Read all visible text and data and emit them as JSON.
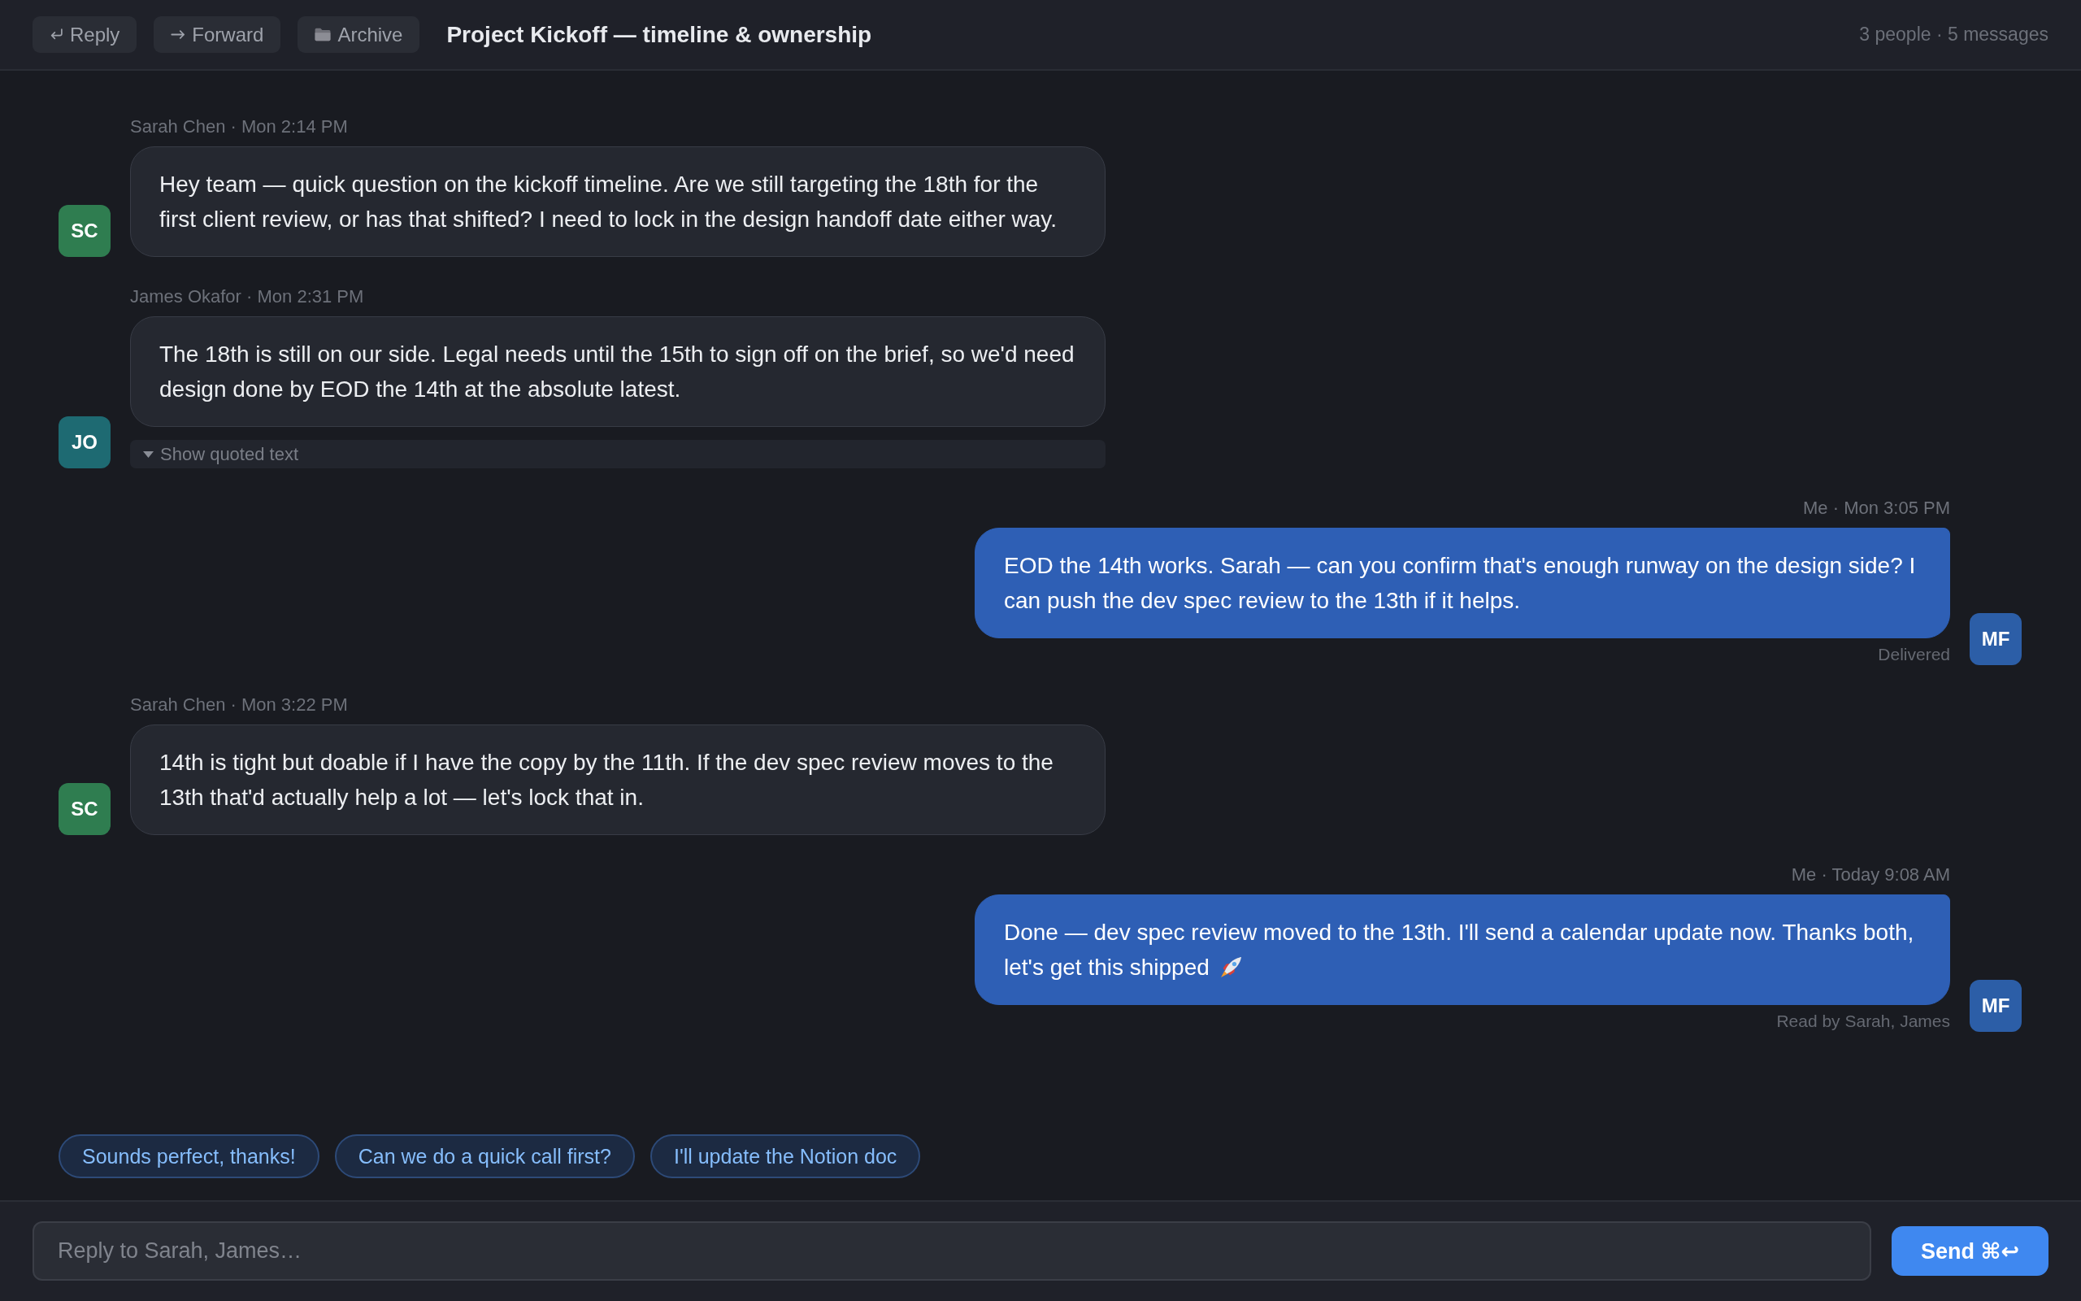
{
  "header": {
    "buttons": [
      {
        "kind": "reply",
        "label": "Reply"
      },
      {
        "kind": "forward",
        "label": "Forward"
      },
      {
        "kind": "archive",
        "label": "Archive"
      }
    ],
    "title": "Project Kickoff — timeline & ownership",
    "summary": "3 people · 5 messages"
  },
  "messages": [
    {
      "kind": "received",
      "meta": "Sarah Chen · Mon 2:14 PM",
      "initials": "SC",
      "color": "#2f7d50",
      "text": "Hey team — quick question on the kickoff timeline. Are we still targeting the 18th for the first client review, or has that shifted? I need to lock in the design handoff date either way."
    },
    {
      "kind": "received",
      "meta": "James Okafor · Mon 2:31 PM",
      "initials": "JO",
      "color": "#1e6a72",
      "text": "The 18th is still on our side. Legal needs until the 15th to sign off on the brief, so we'd need design done by EOD the 14th at the absolute latest.",
      "quoted_toggle": "Show quoted text"
    },
    {
      "kind": "sent",
      "meta": "Me · Mon 3:05 PM",
      "initials": "MF",
      "color": "#2c5ea7",
      "text": "EOD the 14th works. Sarah — can you confirm that's enough runway on the design side? I can push the dev spec review to the 13th if it helps.",
      "status": "Delivered"
    },
    {
      "kind": "received",
      "meta": "Sarah Chen · Mon 3:22 PM",
      "initials": "SC",
      "color": "#2f7d50",
      "text": "14th is tight but doable if I have the copy by the 11th. If the dev spec review moves to the 13th that'd actually help a lot — let's lock that in."
    },
    {
      "kind": "sent",
      "meta": "Me · Today 9:08 AM",
      "initials": "MF",
      "color": "#2c5ea7",
      "text": "Done — dev spec review moved to the 13th. I'll send a calendar update now. Thanks both, let's get this shipped",
      "trailing_emoji": true,
      "status": "Read by Sarah, James"
    }
  ],
  "quick_replies": [
    "Sounds perfect, thanks!",
    "Can we do a quick call first?",
    "I'll update the Notion doc"
  ],
  "composer": {
    "placeholder": "Reply to Sarah, James…",
    "send_label": "Send ⌘↩"
  }
}
